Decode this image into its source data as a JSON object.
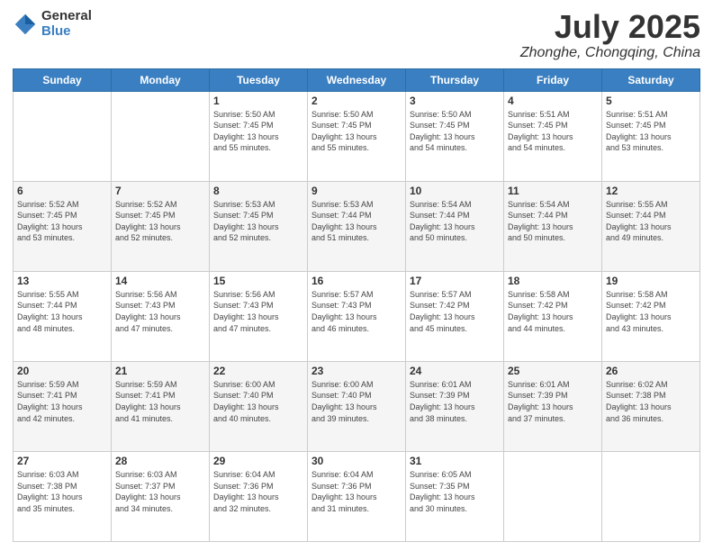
{
  "header": {
    "logo_general": "General",
    "logo_blue": "Blue",
    "month_title": "July 2025",
    "subtitle": "Zhonghe, Chongqing, China"
  },
  "calendar": {
    "weekdays": [
      "Sunday",
      "Monday",
      "Tuesday",
      "Wednesday",
      "Thursday",
      "Friday",
      "Saturday"
    ],
    "weeks": [
      [
        {
          "day": "",
          "info": ""
        },
        {
          "day": "",
          "info": ""
        },
        {
          "day": "1",
          "info": "Sunrise: 5:50 AM\nSunset: 7:45 PM\nDaylight: 13 hours\nand 55 minutes."
        },
        {
          "day": "2",
          "info": "Sunrise: 5:50 AM\nSunset: 7:45 PM\nDaylight: 13 hours\nand 55 minutes."
        },
        {
          "day": "3",
          "info": "Sunrise: 5:50 AM\nSunset: 7:45 PM\nDaylight: 13 hours\nand 54 minutes."
        },
        {
          "day": "4",
          "info": "Sunrise: 5:51 AM\nSunset: 7:45 PM\nDaylight: 13 hours\nand 54 minutes."
        },
        {
          "day": "5",
          "info": "Sunrise: 5:51 AM\nSunset: 7:45 PM\nDaylight: 13 hours\nand 53 minutes."
        }
      ],
      [
        {
          "day": "6",
          "info": "Sunrise: 5:52 AM\nSunset: 7:45 PM\nDaylight: 13 hours\nand 53 minutes."
        },
        {
          "day": "7",
          "info": "Sunrise: 5:52 AM\nSunset: 7:45 PM\nDaylight: 13 hours\nand 52 minutes."
        },
        {
          "day": "8",
          "info": "Sunrise: 5:53 AM\nSunset: 7:45 PM\nDaylight: 13 hours\nand 52 minutes."
        },
        {
          "day": "9",
          "info": "Sunrise: 5:53 AM\nSunset: 7:44 PM\nDaylight: 13 hours\nand 51 minutes."
        },
        {
          "day": "10",
          "info": "Sunrise: 5:54 AM\nSunset: 7:44 PM\nDaylight: 13 hours\nand 50 minutes."
        },
        {
          "day": "11",
          "info": "Sunrise: 5:54 AM\nSunset: 7:44 PM\nDaylight: 13 hours\nand 50 minutes."
        },
        {
          "day": "12",
          "info": "Sunrise: 5:55 AM\nSunset: 7:44 PM\nDaylight: 13 hours\nand 49 minutes."
        }
      ],
      [
        {
          "day": "13",
          "info": "Sunrise: 5:55 AM\nSunset: 7:44 PM\nDaylight: 13 hours\nand 48 minutes."
        },
        {
          "day": "14",
          "info": "Sunrise: 5:56 AM\nSunset: 7:43 PM\nDaylight: 13 hours\nand 47 minutes."
        },
        {
          "day": "15",
          "info": "Sunrise: 5:56 AM\nSunset: 7:43 PM\nDaylight: 13 hours\nand 47 minutes."
        },
        {
          "day": "16",
          "info": "Sunrise: 5:57 AM\nSunset: 7:43 PM\nDaylight: 13 hours\nand 46 minutes."
        },
        {
          "day": "17",
          "info": "Sunrise: 5:57 AM\nSunset: 7:42 PM\nDaylight: 13 hours\nand 45 minutes."
        },
        {
          "day": "18",
          "info": "Sunrise: 5:58 AM\nSunset: 7:42 PM\nDaylight: 13 hours\nand 44 minutes."
        },
        {
          "day": "19",
          "info": "Sunrise: 5:58 AM\nSunset: 7:42 PM\nDaylight: 13 hours\nand 43 minutes."
        }
      ],
      [
        {
          "day": "20",
          "info": "Sunrise: 5:59 AM\nSunset: 7:41 PM\nDaylight: 13 hours\nand 42 minutes."
        },
        {
          "day": "21",
          "info": "Sunrise: 5:59 AM\nSunset: 7:41 PM\nDaylight: 13 hours\nand 41 minutes."
        },
        {
          "day": "22",
          "info": "Sunrise: 6:00 AM\nSunset: 7:40 PM\nDaylight: 13 hours\nand 40 minutes."
        },
        {
          "day": "23",
          "info": "Sunrise: 6:00 AM\nSunset: 7:40 PM\nDaylight: 13 hours\nand 39 minutes."
        },
        {
          "day": "24",
          "info": "Sunrise: 6:01 AM\nSunset: 7:39 PM\nDaylight: 13 hours\nand 38 minutes."
        },
        {
          "day": "25",
          "info": "Sunrise: 6:01 AM\nSunset: 7:39 PM\nDaylight: 13 hours\nand 37 minutes."
        },
        {
          "day": "26",
          "info": "Sunrise: 6:02 AM\nSunset: 7:38 PM\nDaylight: 13 hours\nand 36 minutes."
        }
      ],
      [
        {
          "day": "27",
          "info": "Sunrise: 6:03 AM\nSunset: 7:38 PM\nDaylight: 13 hours\nand 35 minutes."
        },
        {
          "day": "28",
          "info": "Sunrise: 6:03 AM\nSunset: 7:37 PM\nDaylight: 13 hours\nand 34 minutes."
        },
        {
          "day": "29",
          "info": "Sunrise: 6:04 AM\nSunset: 7:36 PM\nDaylight: 13 hours\nand 32 minutes."
        },
        {
          "day": "30",
          "info": "Sunrise: 6:04 AM\nSunset: 7:36 PM\nDaylight: 13 hours\nand 31 minutes."
        },
        {
          "day": "31",
          "info": "Sunrise: 6:05 AM\nSunset: 7:35 PM\nDaylight: 13 hours\nand 30 minutes."
        },
        {
          "day": "",
          "info": ""
        },
        {
          "day": "",
          "info": ""
        }
      ]
    ]
  }
}
